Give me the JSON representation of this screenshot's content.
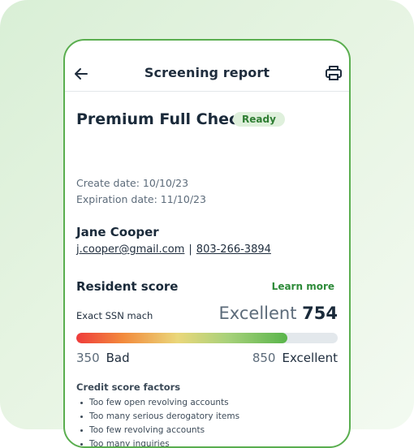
{
  "appbar": {
    "title": "Screening report",
    "back_icon": "arrow-left-icon",
    "print_icon": "printer-icon"
  },
  "report": {
    "title": "Premium Full Check",
    "status": "Ready",
    "create_date": "Create date: 10/10/23",
    "expiration_date": "Expiration date: 11/10/23"
  },
  "applicant": {
    "name": "Jane Cooper",
    "email": "j.cooper@gmail.com",
    "separator": "|",
    "phone": "803-266-3894"
  },
  "resident_score": {
    "title": "Resident score",
    "learn_more": "Learn more",
    "ssn_match": "Exact SSN mach",
    "rating": "Excellent",
    "score": "754",
    "min": "350",
    "min_label": "Bad",
    "max": "850",
    "max_label": "Excellent",
    "score_fraction": 0.808
  },
  "factors": {
    "title": "Credit score factors",
    "items": [
      "Too few open revolving accounts",
      "Too many serious derogatory items",
      "Too few revolving accounts",
      "Too many inquiries"
    ]
  },
  "colors": {
    "accent": "#5aae4f",
    "badge_bg": "#dff0dc",
    "badge_text": "#2e7d32",
    "link_green": "#2e8b3a"
  }
}
